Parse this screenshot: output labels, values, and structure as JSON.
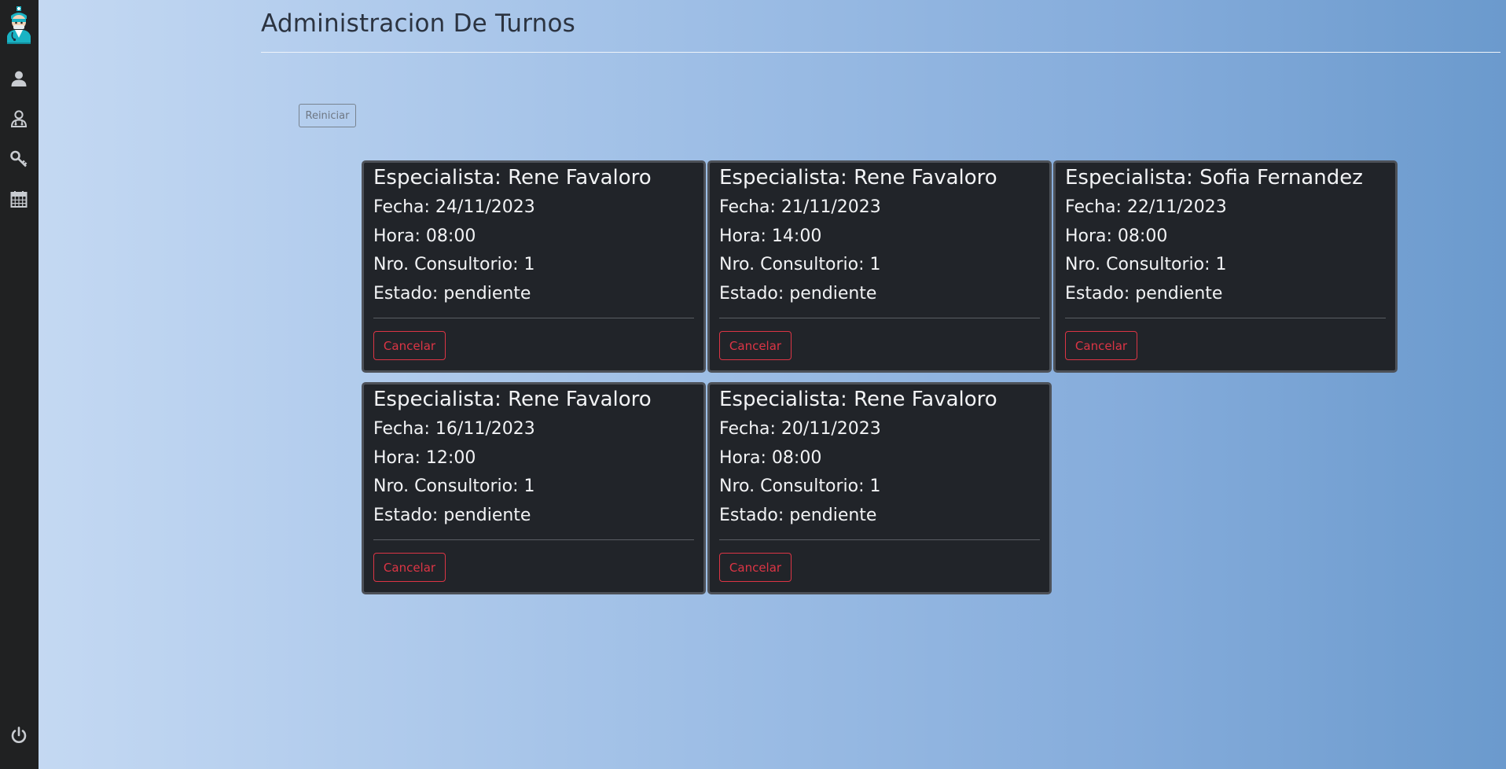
{
  "header": {
    "title": "Administracion De Turnos",
    "reset_label": "Reiniciar"
  },
  "sidebar": {
    "items": [
      {
        "icon": "user-icon"
      },
      {
        "icon": "doctor-icon"
      },
      {
        "icon": "key-icon"
      },
      {
        "icon": "calendar-icon"
      }
    ],
    "logout_icon": "power-icon",
    "logo_icon": "doctor-avatar-icon"
  },
  "turnos": [
    {
      "especialista": "Especialista: Rene Favaloro",
      "fecha": "Fecha: 24/11/2023",
      "hora": "Hora: 08:00",
      "consultorio": "Nro. Consultorio: 1",
      "estado": "Estado: pendiente",
      "action": "Cancelar"
    },
    {
      "especialista": "Especialista: Rene Favaloro",
      "fecha": "Fecha: 21/11/2023",
      "hora": "Hora: 14:00",
      "consultorio": "Nro. Consultorio: 1",
      "estado": "Estado: pendiente",
      "action": "Cancelar"
    },
    {
      "especialista": "Especialista: Sofia Fernandez",
      "fecha": "Fecha: 22/11/2023",
      "hora": "Hora: 08:00",
      "consultorio": "Nro. Consultorio: 1",
      "estado": "Estado: pendiente",
      "action": "Cancelar"
    },
    {
      "especialista": "Especialista: Rene Favaloro",
      "fecha": "Fecha: 16/11/2023",
      "hora": "Hora: 12:00",
      "consultorio": "Nro. Consultorio: 1",
      "estado": "Estado: pendiente",
      "action": "Cancelar"
    },
    {
      "especialista": "Especialista: Rene Favaloro",
      "fecha": "Fecha: 20/11/2023",
      "hora": "Hora: 08:00",
      "consultorio": "Nro. Consultorio: 1",
      "estado": "Estado: pendiente",
      "action": "Cancelar"
    }
  ],
  "colors": {
    "sidebar": "#202122",
    "card": "#212429",
    "danger": "#dc3545",
    "gradient_start": "#c6daf3",
    "gradient_end": "#6b9acd"
  }
}
